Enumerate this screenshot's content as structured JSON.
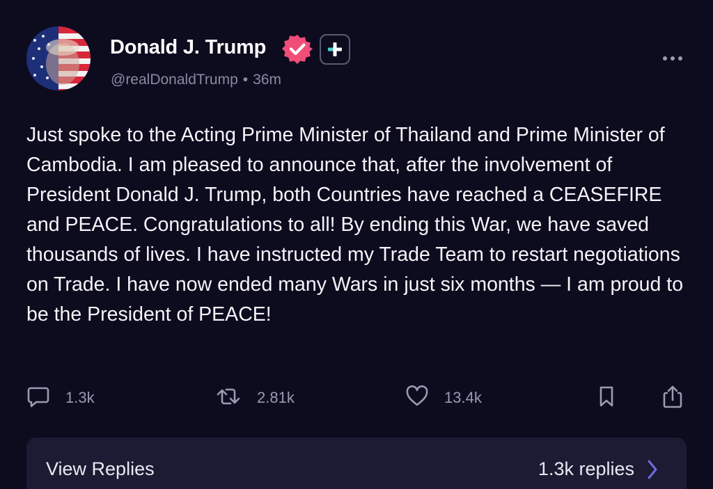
{
  "author": {
    "display_name": "Donald J. Trump",
    "handle": "@realDonaldTrump",
    "separator": "•",
    "time_ago": "36m",
    "verified_color": "#f04e79"
  },
  "post": {
    "text": "Just spoke to the Acting Prime Minister of Thailand and Prime Minister of Cambodia. I am pleased to announce that, after the involvement of President Donald J. Trump, both Countries have reached a CEASEFIRE and PEACE. Congratulations to all! By ending this War, we have saved thousands of lives. I have instructed my Trade Team to restart negotiations on Trade. I have now ended many Wars in just six months — I am proud to be the President of PEACE!"
  },
  "actions": {
    "replies": "1.3k",
    "reposts": "2.81k",
    "likes": "13.4k"
  },
  "icons": {
    "reply": "speech-bubble-icon",
    "repost": "repost-arrows-icon",
    "like": "heart-icon",
    "save": "bookmark-icon",
    "share": "share-upload-icon",
    "more": "ellipsis-icon"
  },
  "replies_card": {
    "label": "View Replies",
    "count": "1.3k replies"
  },
  "colors": {
    "background": "#0d0b1e",
    "card": "#1c1b33",
    "muted": "#8a8aa3",
    "accent": "#6f6be0"
  }
}
